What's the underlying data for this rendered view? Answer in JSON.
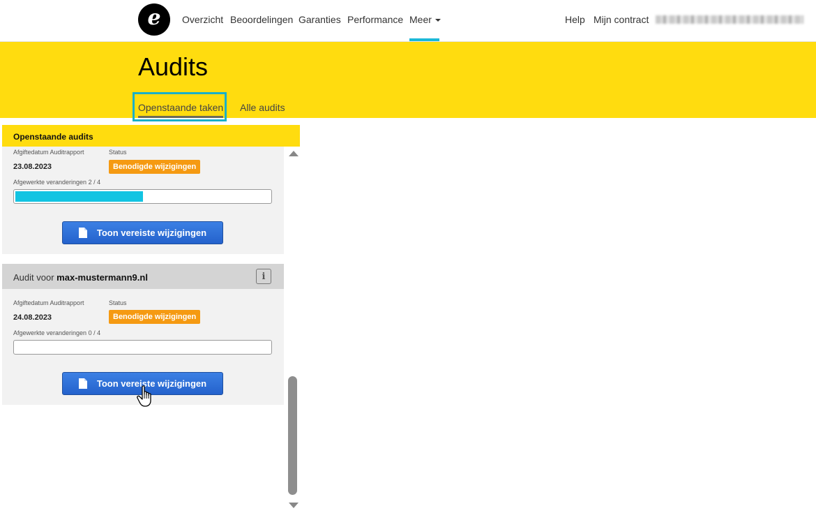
{
  "nav": {
    "logo_letter": "e",
    "items": [
      "Overzicht",
      "Beoordelingen",
      "Garanties",
      "Performance",
      "Meer"
    ],
    "active": "Meer",
    "help": "Help",
    "contract": "Mijn contract",
    "accent_color": "#1ab8d8"
  },
  "header": {
    "title": "Audits",
    "tabs": [
      "Openstaande taken",
      "Alle audits"
    ],
    "active_tab": "Openstaande taken",
    "background_color": "#ffdc0f"
  },
  "panel": {
    "title": "Openstaande audits",
    "cards": [
      {
        "title_prefix": "",
        "domain": "",
        "date_label": "Afgiftedatum Auditrapport",
        "status_label": "Status",
        "date": "23.08.2023",
        "status": "Benodigde wijzigingen",
        "progress_label": "Afgewerkte veranderingen 2 / 4",
        "progress_fraction": 0.5,
        "button": "Toon vereiste wijzigingen"
      },
      {
        "title_prefix": "Audit voor",
        "domain": "max-mustermann9.nl",
        "date_label": "Afgiftedatum Auditrapport",
        "status_label": "Status",
        "date": "24.08.2023",
        "status": "Benodigde wijzigingen",
        "progress_label": "Afgewerkte veranderingen 0 / 4",
        "progress_fraction": 0,
        "button": "Toon vereiste wijzigingen"
      }
    ]
  },
  "colors": {
    "status_badge": "#f59a12",
    "progress_fill": "#12c4e2",
    "button": "#2f6fd8"
  }
}
